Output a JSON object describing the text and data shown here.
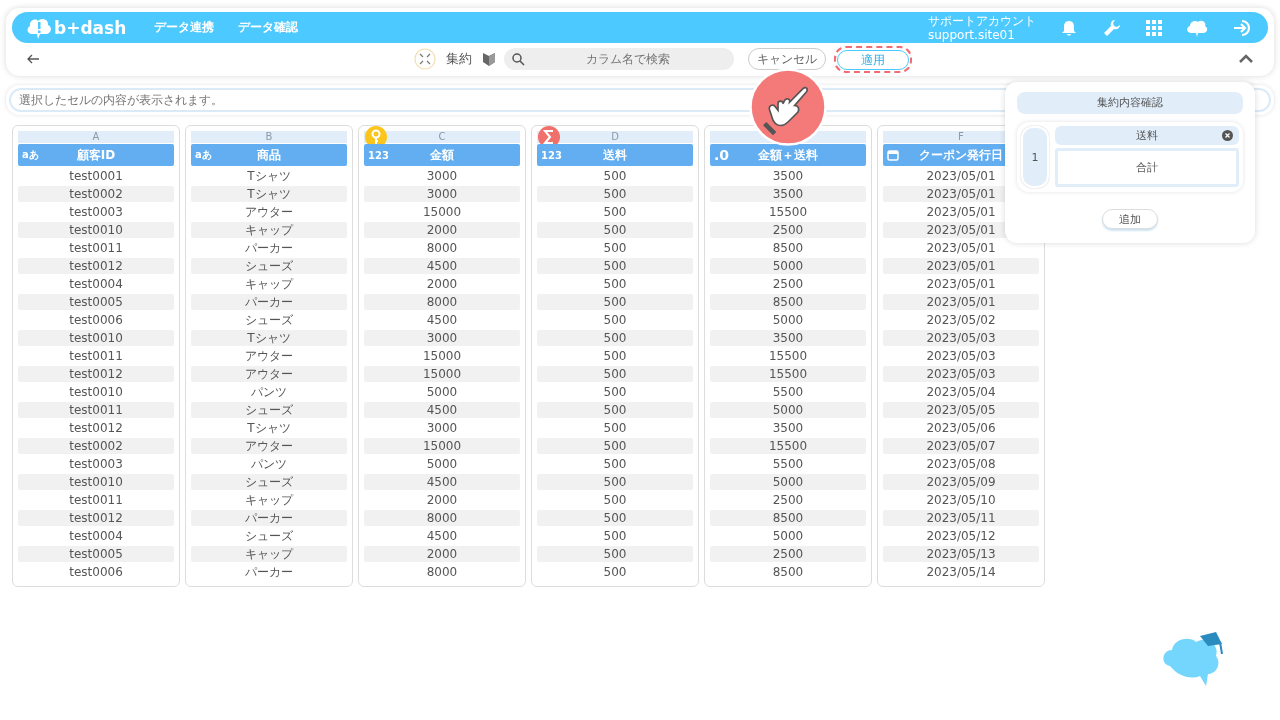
{
  "header": {
    "logo": "b+dash",
    "nav": [
      "データ連携",
      "データ確認"
    ],
    "account": {
      "name": "サポートアカウント",
      "id": "support.site01"
    }
  },
  "toolbar": {
    "mode": "集約",
    "search": {
      "placeholder": "カラム名で検索"
    },
    "cancel": "キャンセル",
    "apply": "適用"
  },
  "cell_preview": {
    "placeholder": "選択したセルの内容が表示されます。"
  },
  "columns": [
    {
      "letter": "A",
      "name": "顧客ID",
      "kind": "text",
      "type_label": "aあ"
    },
    {
      "letter": "B",
      "name": "商品",
      "kind": "text",
      "type_label": "aあ"
    },
    {
      "letter": "C",
      "name": "金額",
      "kind": "number",
      "type_label": "123",
      "badge": {
        "kind": "key"
      }
    },
    {
      "letter": "D",
      "name": "送料",
      "kind": "number",
      "type_label": "123",
      "badge": {
        "kind": "sum"
      }
    },
    {
      "name": "金額＋送料",
      "kind": "decimal",
      "type_label": ".0"
    },
    {
      "letter": "F",
      "name": "クーポン発行日",
      "kind": "date"
    }
  ],
  "rows": [
    [
      "test0001",
      "Tシャツ",
      "3000",
      "500",
      "3500",
      "2023/05/01"
    ],
    [
      "test0002",
      "Tシャツ",
      "3000",
      "500",
      "3500",
      "2023/05/01"
    ],
    [
      "test0003",
      "アウター",
      "15000",
      "500",
      "15500",
      "2023/05/01"
    ],
    [
      "test0010",
      "キャップ",
      "2000",
      "500",
      "2500",
      "2023/05/01"
    ],
    [
      "test0011",
      "パーカー",
      "8000",
      "500",
      "8500",
      "2023/05/01"
    ],
    [
      "test0012",
      "シューズ",
      "4500",
      "500",
      "5000",
      "2023/05/01"
    ],
    [
      "test0004",
      "キャップ",
      "2000",
      "500",
      "2500",
      "2023/05/01"
    ],
    [
      "test0005",
      "パーカー",
      "8000",
      "500",
      "8500",
      "2023/05/01"
    ],
    [
      "test0006",
      "シューズ",
      "4500",
      "500",
      "5000",
      "2023/05/02"
    ],
    [
      "test0010",
      "Tシャツ",
      "3000",
      "500",
      "3500",
      "2023/05/03"
    ],
    [
      "test0011",
      "アウター",
      "15000",
      "500",
      "15500",
      "2023/05/03"
    ],
    [
      "test0012",
      "アウター",
      "15000",
      "500",
      "15500",
      "2023/05/03"
    ],
    [
      "test0010",
      "パンツ",
      "5000",
      "500",
      "5500",
      "2023/05/04"
    ],
    [
      "test0011",
      "シューズ",
      "4500",
      "500",
      "5000",
      "2023/05/05"
    ],
    [
      "test0012",
      "Tシャツ",
      "3000",
      "500",
      "3500",
      "2023/05/06"
    ],
    [
      "test0002",
      "アウター",
      "15000",
      "500",
      "15500",
      "2023/05/07"
    ],
    [
      "test0003",
      "パンツ",
      "5000",
      "500",
      "5500",
      "2023/05/08"
    ],
    [
      "test0010",
      "シューズ",
      "4500",
      "500",
      "5000",
      "2023/05/09"
    ],
    [
      "test0011",
      "キャップ",
      "2000",
      "500",
      "2500",
      "2023/05/10"
    ],
    [
      "test0012",
      "パーカー",
      "8000",
      "500",
      "8500",
      "2023/05/11"
    ],
    [
      "test0004",
      "シューズ",
      "4500",
      "500",
      "5000",
      "2023/05/12"
    ],
    [
      "test0005",
      "キャップ",
      "2000",
      "500",
      "2500",
      "2023/05/13"
    ],
    [
      "test0006",
      "パーカー",
      "8000",
      "500",
      "8500",
      "2023/05/14"
    ]
  ],
  "aggregation_panel": {
    "title": "集約内容確認",
    "items": [
      {
        "number": "1",
        "column": "送料",
        "function": "合計"
      }
    ],
    "add": "追加"
  }
}
